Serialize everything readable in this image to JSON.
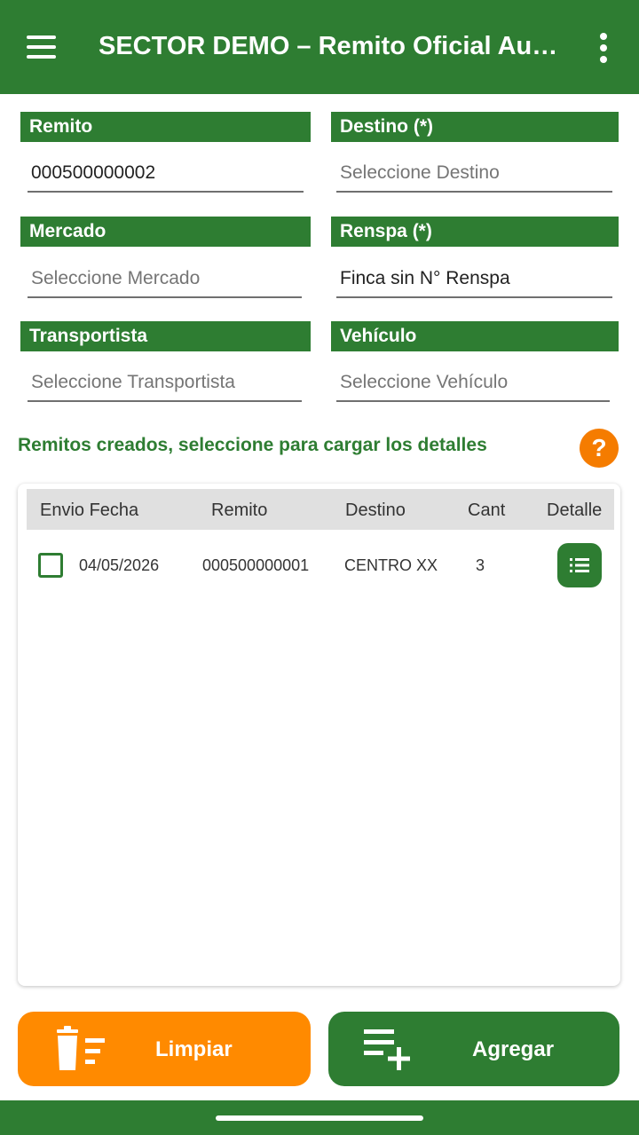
{
  "app_bar": {
    "title": "SECTOR DEMO – Remito Oficial Aut…",
    "menu_icon": "hamburger-menu-icon",
    "overflow_icon": "more-vert-icon"
  },
  "form": {
    "remito": {
      "label": "Remito",
      "value": "000500000002"
    },
    "destino": {
      "label": "Destino (*)",
      "placeholder": "Seleccione Destino"
    },
    "mercado": {
      "label": "Mercado",
      "placeholder": "Seleccione Mercado"
    },
    "renspa": {
      "label": "Renspa (*)",
      "value": "Finca sin N° Renspa"
    },
    "transportista": {
      "label": "Transportista",
      "placeholder": "Seleccione Transportista"
    },
    "vehiculo": {
      "label": "Vehículo",
      "placeholder": "Seleccione Vehículo"
    }
  },
  "hint": "Remitos creados, seleccione para cargar los detalles",
  "help_label": "?",
  "table": {
    "columns": [
      "Envio Fecha",
      "Remito",
      "Destino",
      "Cant",
      "Detalle"
    ],
    "rows": [
      {
        "checked": false,
        "fecha": "04/05/2026",
        "remito": "000500000001",
        "destino": "CENTRO XX",
        "cant": "3"
      }
    ]
  },
  "buttons": {
    "clear_label": "Limpiar",
    "add_label": "Agregar"
  },
  "colors": {
    "primary": "#2e7d32",
    "accent": "#ff8a00",
    "help": "#f57c00"
  }
}
